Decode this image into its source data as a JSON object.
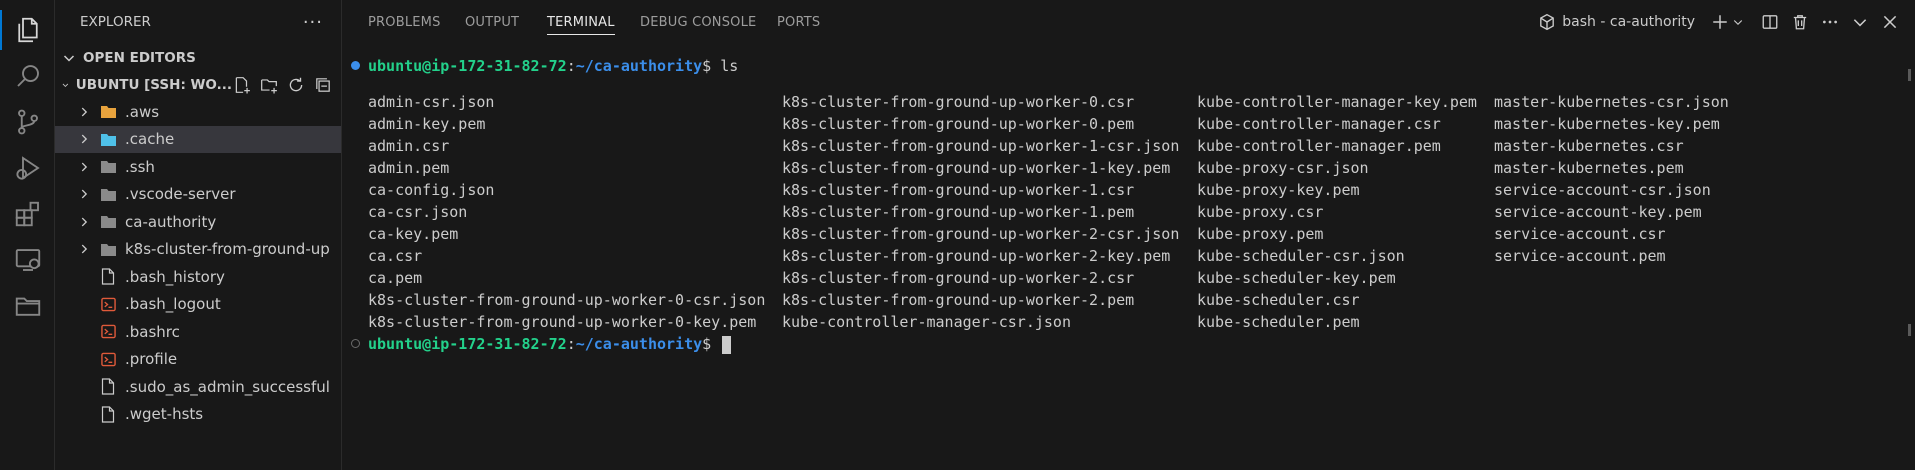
{
  "activity_bar": {
    "items": [
      {
        "name": "explorer-icon",
        "active": true
      },
      {
        "name": "search-icon"
      },
      {
        "name": "source-control-icon"
      },
      {
        "name": "run-debug-icon"
      },
      {
        "name": "extensions-icon"
      },
      {
        "name": "remote-explorer-icon"
      },
      {
        "name": "project-manager-icon"
      }
    ]
  },
  "sidebar": {
    "title": "EXPLORER",
    "more": "···",
    "open_editors_label": "OPEN EDITORS",
    "workspace_label": "UBUNTU [SSH: WO...",
    "items": [
      {
        "label": ".aws",
        "type": "folder",
        "icon_color": "#e8a33d"
      },
      {
        "label": ".cache",
        "type": "folder",
        "icon_color": "#4fc1e9",
        "selected": true
      },
      {
        "label": ".ssh",
        "type": "folder",
        "icon_color": "#8a8a8a"
      },
      {
        "label": ".vscode-server",
        "type": "folder",
        "icon_color": "#8a8a8a"
      },
      {
        "label": "ca-authority",
        "type": "folder",
        "icon_color": "#8a8a8a"
      },
      {
        "label": "k8s-cluster-from-ground-up",
        "type": "folder",
        "icon_color": "#8a8a8a"
      },
      {
        "label": ".bash_history",
        "type": "file",
        "icon_color": "#cccccc"
      },
      {
        "label": ".bash_logout",
        "type": "shell",
        "icon_color": "#e05a3a"
      },
      {
        "label": ".bashrc",
        "type": "shell",
        "icon_color": "#e05a3a"
      },
      {
        "label": ".profile",
        "type": "shell",
        "icon_color": "#e05a3a"
      },
      {
        "label": ".sudo_as_admin_successful",
        "type": "file",
        "icon_color": "#cccccc"
      },
      {
        "label": ".wget-hsts",
        "type": "file",
        "icon_color": "#cccccc"
      }
    ]
  },
  "panel": {
    "tabs": [
      "PROBLEMS",
      "OUTPUT",
      "TERMINAL",
      "DEBUG CONSOLE",
      "PORTS"
    ],
    "active_tab": "TERMINAL",
    "terminal_name": "bash - ca-authority"
  },
  "terminal": {
    "prompt_user": "ubuntu@ip-172-31-82-72",
    "prompt_sep": ":",
    "prompt_path": "~/ca-authority",
    "prompt_suffix": "$ ",
    "command": "ls",
    "ls_columns": [
      [
        "admin-csr.json",
        "admin-key.pem",
        "admin.csr",
        "admin.pem",
        "ca-config.json",
        "ca-csr.json",
        "ca-key.pem",
        "ca.csr",
        "ca.pem",
        "k8s-cluster-from-ground-up-worker-0-csr.json",
        "k8s-cluster-from-ground-up-worker-0-key.pem"
      ],
      [
        "k8s-cluster-from-ground-up-worker-0.csr",
        "k8s-cluster-from-ground-up-worker-0.pem",
        "k8s-cluster-from-ground-up-worker-1-csr.json",
        "k8s-cluster-from-ground-up-worker-1-key.pem",
        "k8s-cluster-from-ground-up-worker-1.csr",
        "k8s-cluster-from-ground-up-worker-1.pem",
        "k8s-cluster-from-ground-up-worker-2-csr.json",
        "k8s-cluster-from-ground-up-worker-2-key.pem",
        "k8s-cluster-from-ground-up-worker-2.csr",
        "k8s-cluster-from-ground-up-worker-2.pem",
        "kube-controller-manager-csr.json"
      ],
      [
        "kube-controller-manager-key.pem",
        "kube-controller-manager.csr",
        "kube-controller-manager.pem",
        "kube-proxy-csr.json",
        "kube-proxy-key.pem",
        "kube-proxy.csr",
        "kube-proxy.pem",
        "kube-scheduler-csr.json",
        "kube-scheduler-key.pem",
        "kube-scheduler.csr",
        "kube-scheduler.pem"
      ],
      [
        "master-kubernetes-csr.json",
        "master-kubernetes-key.pem",
        "master-kubernetes.csr",
        "master-kubernetes.pem",
        "service-account-csr.json",
        "service-account-key.pem",
        "service-account.csr",
        "service-account.pem"
      ]
    ]
  }
}
